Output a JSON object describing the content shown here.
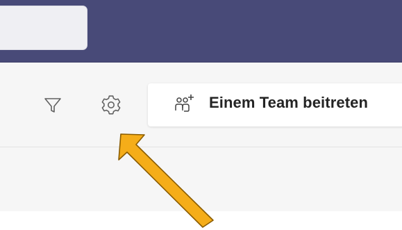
{
  "toolbar": {
    "filter_icon": "filter-icon",
    "settings_icon": "gear-icon",
    "join_team": {
      "icon": "people-add-icon",
      "label": "Einem Team beitreten"
    }
  },
  "annotation": {
    "arrow_color": "#f5ad19",
    "arrow_outline": "#8a5c00"
  },
  "colors": {
    "title_bar": "#484a78",
    "toolbar_background": "#f6f6f6"
  }
}
